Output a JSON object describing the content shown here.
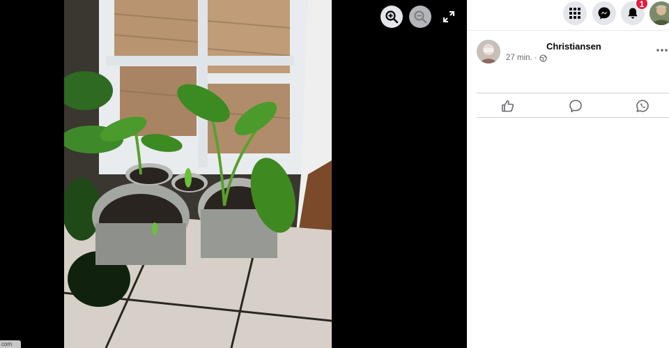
{
  "viewer": {
    "photo_alt": "",
    "url_hint": "com",
    "controls": {
      "zoom_in_icon": "magnifier-plus-icon",
      "zoom_out_icon": "magnifier-minus-icon",
      "fullscreen_icon": "expand-icon"
    }
  },
  "topbar": {
    "menu_icon": "grid-menu-icon",
    "messenger_icon": "messenger-icon",
    "notifications_icon": "bell-icon",
    "notification_count": "1"
  },
  "post": {
    "author_name": "Christiansen",
    "time": "27 min.",
    "audience_icon": "globe-icon",
    "actions": {
      "like_icon": "thumbs-up-icon",
      "comment_icon": "comment-icon",
      "share_icon": "whatsapp-icon"
    }
  },
  "colors": {
    "badge": "#e41e3f",
    "button_bg": "#e4e6eb",
    "text_primary": "#050505",
    "text_secondary": "#65676b"
  }
}
